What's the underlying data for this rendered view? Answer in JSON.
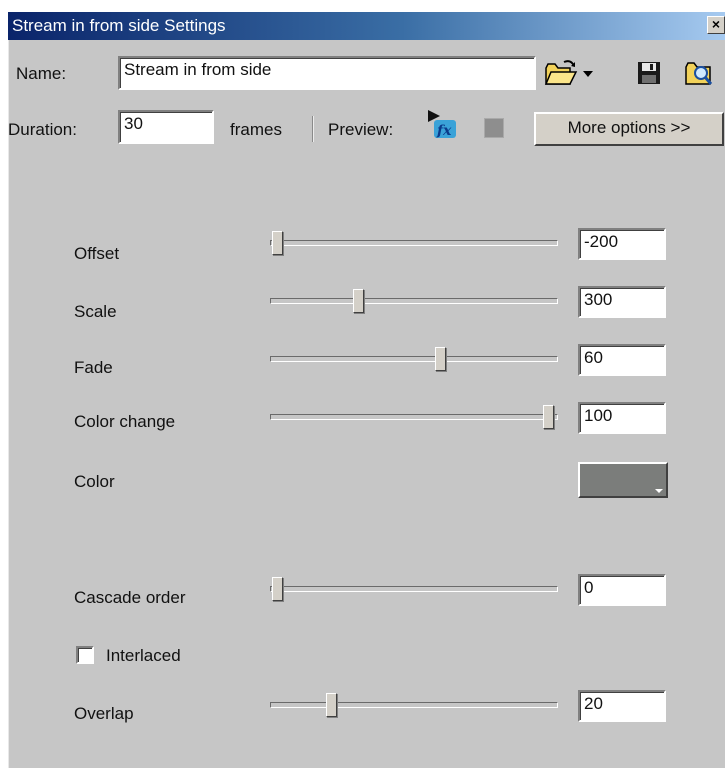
{
  "window": {
    "title": "Stream in from side Settings",
    "close_glyph": "×"
  },
  "toolbar": {
    "name_label": "Name:",
    "name_value": "Stream in from side",
    "duration_label": "Duration:",
    "duration_value": "30",
    "frames_label": "frames",
    "preview_label": "Preview:",
    "more_options_label": "More options >>",
    "icons": [
      "open-folder-icon",
      "dropdown-arrow-icon",
      "save-disk-icon",
      "browse-folder-icon",
      "preview-fx-icon",
      "stop-square-icon"
    ]
  },
  "settings": {
    "offset": {
      "label": "Offset",
      "value": "-200",
      "slider_fraction": 0.0
    },
    "scale": {
      "label": "Scale",
      "value": "300",
      "slider_fraction": 0.3
    },
    "fade": {
      "label": "Fade",
      "value": "60",
      "slider_fraction": 0.6
    },
    "color_change": {
      "label": "Color change",
      "value": "100",
      "slider_fraction": 1.0
    },
    "color": {
      "label": "Color",
      "swatch": "#7b7d7b"
    },
    "cascade_order": {
      "label": "Cascade order",
      "value": "0",
      "slider_fraction": 0.0
    },
    "interlaced": {
      "label": "Interlaced",
      "checked": false
    },
    "overlap": {
      "label": "Overlap",
      "value": "20",
      "slider_fraction": 0.2
    }
  },
  "colors": {
    "dialog_bg": "#c6c6c6",
    "titlebar_start": "#0a246a",
    "titlebar_end": "#a6caf0"
  }
}
